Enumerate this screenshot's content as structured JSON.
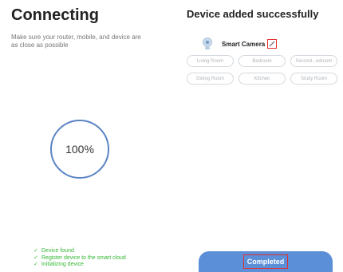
{
  "connecting": {
    "title": "Connecting",
    "subtitle": "Make sure your router, mobile, and device are as close as possible",
    "progress_text": "100%",
    "progress_fraction": 1.0,
    "ring_color": "#5b84c4",
    "steps": [
      "Device found",
      "Register device to the smart cloud",
      "Initializing device"
    ],
    "step_color": "#35b835",
    "check_icon": "check-icon"
  },
  "added": {
    "title": "Device added successfully",
    "device_name": "Smart Camera",
    "device_icon": "camera-icon",
    "edit_icon": "pencil-icon",
    "rooms": [
      "Living Room",
      "Bedroom",
      "Second...edroom",
      "Dining Room",
      "Kitchen",
      "Study Room"
    ],
    "completed_label": "Completed",
    "button_color": "#5b8fd8",
    "highlight_color": "#e03030"
  }
}
